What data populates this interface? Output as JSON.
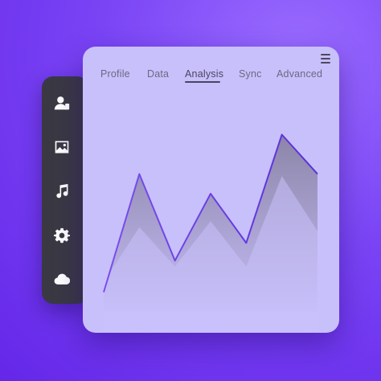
{
  "sidebar": {
    "items": [
      {
        "icon": "user-icon"
      },
      {
        "icon": "image-icon"
      },
      {
        "icon": "music-icon"
      },
      {
        "icon": "gear-icon"
      },
      {
        "icon": "cloud-icon"
      }
    ]
  },
  "tabs": [
    {
      "label": "Profile"
    },
    {
      "label": "Data"
    },
    {
      "label": "Analysis",
      "active": true
    },
    {
      "label": "Sync"
    },
    {
      "label": "Advanced"
    }
  ],
  "colors": {
    "background": "#7a44f5",
    "card": "#c8c0fb",
    "sidebar": "#3a3943",
    "line": "#6a3ce0"
  },
  "chart_data": {
    "type": "area",
    "x": [
      0,
      1,
      2,
      3,
      4,
      5,
      6
    ],
    "values": [
      1.0,
      7.0,
      2.6,
      6.0,
      3.5,
      9.0,
      7.0
    ],
    "background_values": [
      1.5,
      4.3,
      2.3,
      4.6,
      2.3,
      6.9,
      4.1
    ],
    "ylim": [
      0,
      10
    ],
    "grid": false
  }
}
